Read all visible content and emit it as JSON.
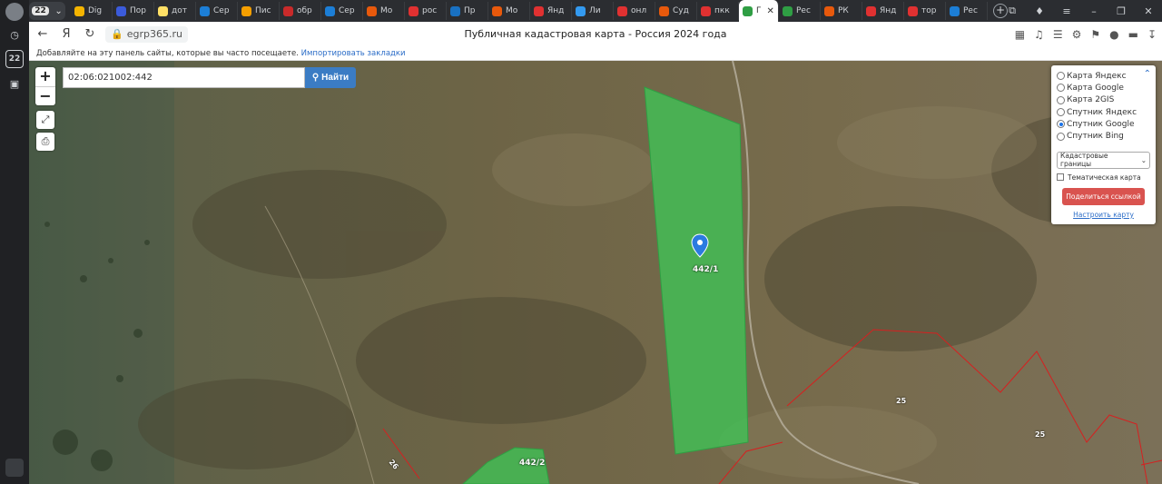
{
  "rail": {
    "badge": "22"
  },
  "tabbar": {
    "counter": "22",
    "tabs": [
      {
        "label": "Dig",
        "color": "#f4b400"
      },
      {
        "label": "Пор",
        "color": "#3b5bdb"
      },
      {
        "label": "дот",
        "color": "#ffe066"
      },
      {
        "label": "Сер",
        "color": "#1c7ed6"
      },
      {
        "label": "Пис",
        "color": "#f59f00"
      },
      {
        "label": "обр",
        "color": "#c92a2a"
      },
      {
        "label": "Сер",
        "color": "#1c7ed6"
      },
      {
        "label": "Мо",
        "color": "#e8590c"
      },
      {
        "label": "рос",
        "color": "#e03131"
      },
      {
        "label": "Пр",
        "color": "#1971c2"
      },
      {
        "label": "Мо",
        "color": "#e8590c"
      },
      {
        "label": "Янд",
        "color": "#e03131"
      },
      {
        "label": "Ли",
        "color": "#339af0"
      },
      {
        "label": "онл",
        "color": "#e03131"
      },
      {
        "label": "Суд",
        "color": "#e8590c"
      },
      {
        "label": "пкк",
        "color": "#e03131"
      },
      {
        "label": "Г",
        "color": "#2f9e44",
        "active": true
      },
      {
        "label": "Рес",
        "color": "#2f9e44"
      },
      {
        "label": "РК",
        "color": "#e8590c"
      },
      {
        "label": "Янд",
        "color": "#e03131"
      },
      {
        "label": "тор",
        "color": "#e03131"
      },
      {
        "label": "Рес",
        "color": "#1c7ed6"
      }
    ]
  },
  "toolbar": {
    "url": "egrp365.ru",
    "page_title": "Публичная кадастровая карта - Россия 2024 года"
  },
  "bookmarks": {
    "text": "Добавляйте на эту панель сайты, которые вы часто посещаете.",
    "link": "Импортировать закладки"
  },
  "map": {
    "search_value": "02:06:021002:442",
    "search_button": "Найти",
    "zoom_in": "+",
    "zoom_out": "−",
    "parcels": [
      {
        "label": "442/1",
        "color": "#3fc456"
      },
      {
        "label": "442/2",
        "color": "#3fc456"
      }
    ],
    "boundary_labels": [
      "25",
      "25",
      "26"
    ],
    "boundary_color": "#d62020"
  },
  "layers": {
    "options": [
      {
        "label": "Карта Яндекс",
        "selected": false
      },
      {
        "label": "Карта Google",
        "selected": false
      },
      {
        "label": "Карта 2GIS",
        "selected": false
      },
      {
        "label": "Спутник Яндекс",
        "selected": false
      },
      {
        "label": "Спутник Google",
        "selected": true
      },
      {
        "label": "Спутник Bing",
        "selected": false
      }
    ],
    "select_value": "Кадастровые границы",
    "thematic_label": "Тематическая карта",
    "share_button": "Поделиться ссылкой",
    "configure_link": "Настроить карту"
  }
}
